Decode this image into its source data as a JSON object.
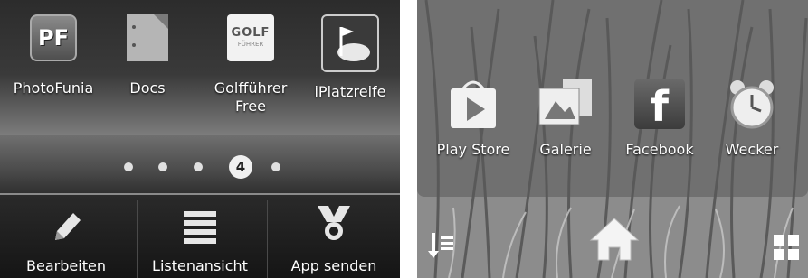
{
  "left_screen": {
    "apps": [
      {
        "label": "PhotoFunia",
        "icon": "photofunia-icon",
        "icon_text": "PF"
      },
      {
        "label": "Docs",
        "icon": "docs-icon"
      },
      {
        "label": "Golfführer\nFree",
        "icon": "golffuehrer-icon",
        "icon_text_top": "GOLF",
        "icon_text_bottom": "FÜHRER"
      },
      {
        "label": "iPlatzreife",
        "icon": "iplatzreife-icon"
      }
    ],
    "page_indicator": {
      "current_page": "4"
    },
    "dock": [
      {
        "label": "Bearbeiten",
        "icon": "pencil-icon"
      },
      {
        "label": "Listenansicht",
        "icon": "list-icon"
      },
      {
        "label": "App senden",
        "icon": "share-icon"
      }
    ]
  },
  "right_screen": {
    "apps": [
      {
        "label": "Play Store",
        "icon": "play-store-icon"
      },
      {
        "label": "Galerie",
        "icon": "gallery-icon"
      },
      {
        "label": "Facebook",
        "icon": "facebook-icon",
        "icon_text": "f"
      },
      {
        "label": "Wecker",
        "icon": "alarm-clock-icon"
      }
    ],
    "nav": [
      {
        "icon": "sort-icon"
      },
      {
        "icon": "home-icon"
      },
      {
        "icon": "app-drawer-icon"
      }
    ]
  }
}
